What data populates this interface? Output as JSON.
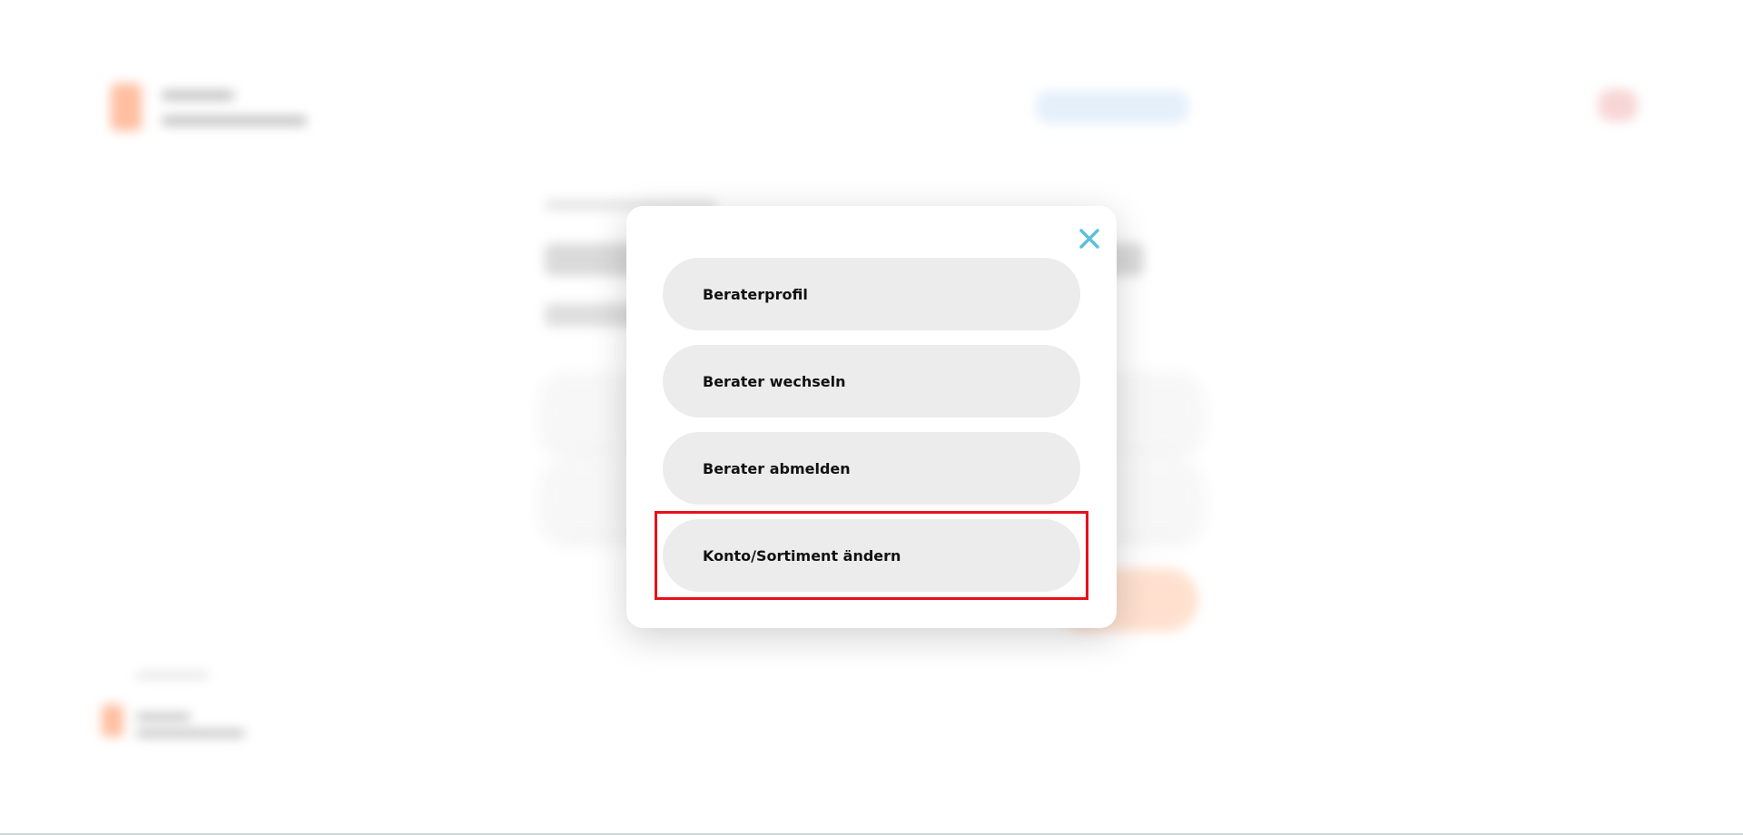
{
  "modal": {
    "close_icon": "close-icon",
    "close_color": "#5bc0de",
    "options": [
      {
        "label": "Beraterprofil"
      },
      {
        "label": "Berater wechseln"
      },
      {
        "label": "Berater abmelden"
      },
      {
        "label": "Konto/Sortiment ändern",
        "highlighted": true
      }
    ]
  },
  "colors": {
    "highlight": "#e8101a",
    "option_bg": "#ececec",
    "accent_orange": "#ff8a55"
  }
}
